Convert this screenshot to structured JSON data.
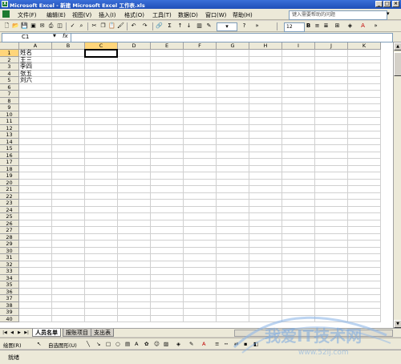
{
  "window": {
    "title": "Microsoft Excel - 新建 Microsoft Excel 工作表.xls",
    "icon_label": "X"
  },
  "menu": {
    "items": [
      "文件(F)",
      "编辑(E)",
      "视图(V)",
      "插入(I)",
      "格式(O)",
      "工具(T)",
      "数据(D)",
      "窗口(W)",
      "帮助(H)"
    ],
    "help_placeholder": "键入需要帮助的问题"
  },
  "toolbar": {
    "font_size": "12",
    "sigma_label": "Σ",
    "icons": [
      "new-icon",
      "open-icon",
      "save-icon",
      "permission-icon",
      "email-icon",
      "print-icon",
      "print-preview-icon",
      "spelling-icon",
      "research-icon",
      "cut-icon",
      "copy-icon",
      "paste-icon",
      "format-painter-icon",
      "undo-icon",
      "redo-icon",
      "hyperlink-icon",
      "autosum-icon",
      "sort-asc-icon",
      "sort-desc-icon",
      "chart-wizard-icon",
      "drawing-icon",
      "zoom-icon",
      "help-icon"
    ]
  },
  "formula_bar": {
    "name_box": "C1",
    "fx_label": "fx",
    "value": ""
  },
  "grid": {
    "columns": [
      "A",
      "B",
      "C",
      "D",
      "E",
      "F",
      "G",
      "H",
      "I",
      "J",
      "K"
    ],
    "selected_column": "C",
    "rows": [
      "1",
      "2",
      "3",
      "4",
      "5",
      "6",
      "7",
      "8",
      "9",
      "10",
      "11",
      "12",
      "13",
      "14",
      "15",
      "16",
      "17",
      "18",
      "19",
      "20",
      "21",
      "22",
      "23",
      "24",
      "25",
      "26",
      "27",
      "28",
      "29",
      "30",
      "31",
      "32",
      "33",
      "34",
      "35",
      "36",
      "37",
      "38",
      "39",
      "40"
    ],
    "selected_cell": "C1",
    "cells": {
      "A1": "姓名",
      "A2": "王三",
      "A3": "李四",
      "A4": "张五",
      "A5": "刘六"
    }
  },
  "sheets": {
    "tabs": [
      "人员名单",
      "报账项目",
      "支出表"
    ],
    "active": 0
  },
  "drawing_toolbar": {
    "draw_label": "绘图(R)",
    "autoshapes_label": "自选图形(U)"
  },
  "status": {
    "text": "就绪"
  },
  "watermark": {
    "text": "我爱IT技术网",
    "url": "www.52ij.com"
  },
  "colors": {
    "title_bar": "#2a5fd0",
    "selection_header": "#ffd57a",
    "chrome": "#ece9d8"
  }
}
